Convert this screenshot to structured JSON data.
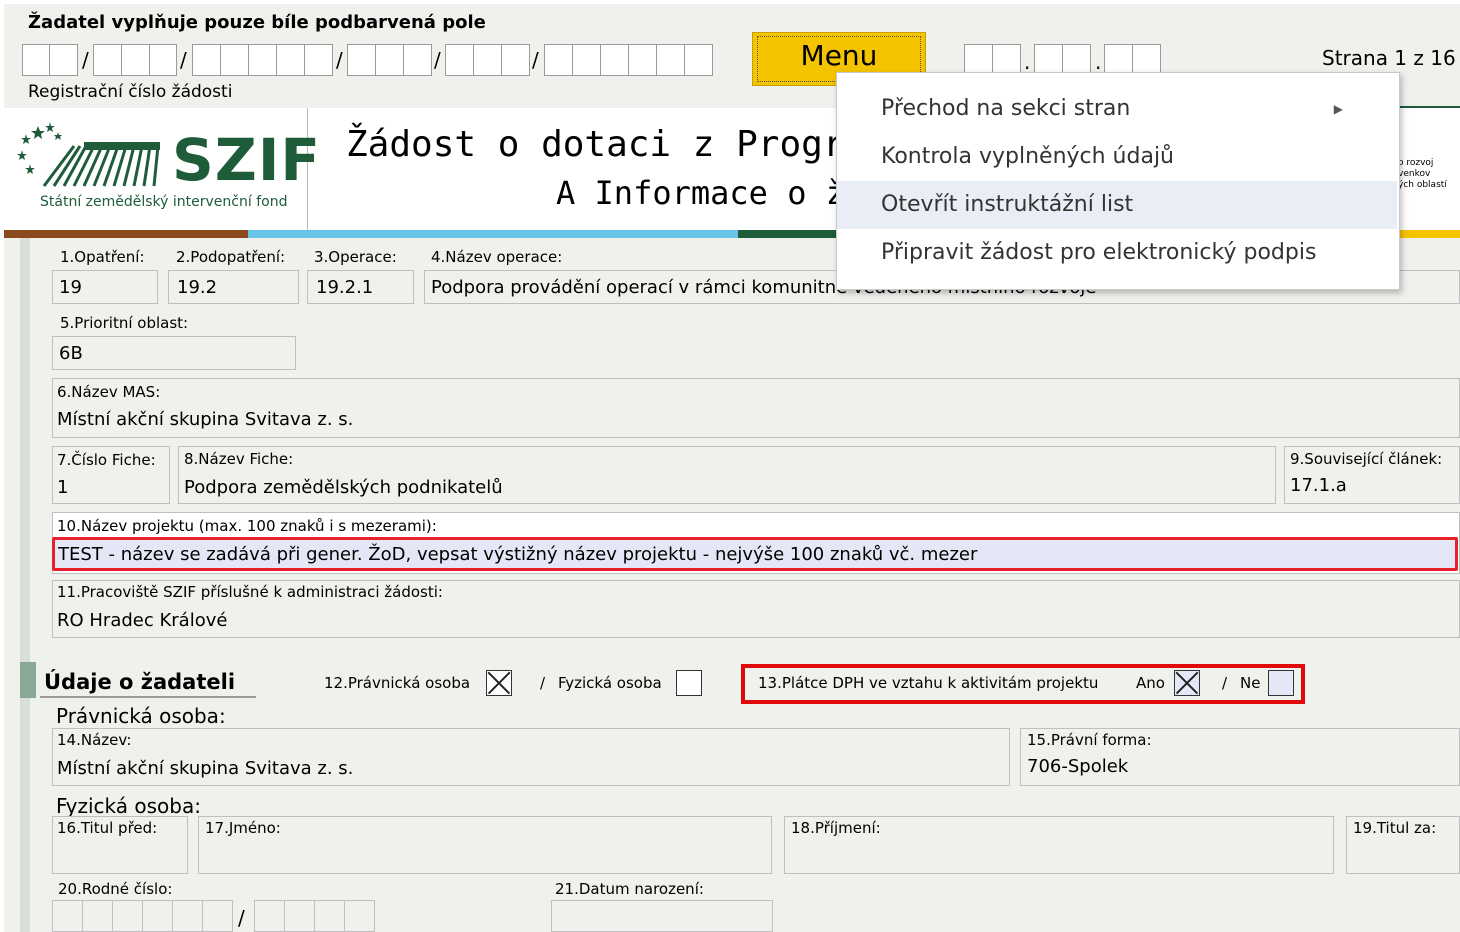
{
  "header": {
    "instruction": "Žadatel vyplňuje pouze bíle podbarvená pole",
    "reg_label": "Registrační číslo žádosti",
    "menu_button": "Menu",
    "page_indicator": "Strana 1 z 16",
    "date_dots": [
      ".",
      "."
    ]
  },
  "logo": {
    "brand": "SZIF",
    "subtitle": "Státní zemědělský intervenční fond"
  },
  "title": {
    "line1": "Žádost o dotaci z Programu",
    "line2": "A Informace o ža"
  },
  "menu": {
    "items": [
      {
        "label": "Přechod na sekci stran",
        "has_submenu": true
      },
      {
        "label": "Kontrola vyplněných údajů"
      },
      {
        "label": "Otevřít instruktážní list"
      },
      {
        "label": "Připravit žádost pro elektronický podpis"
      }
    ],
    "highlighted_index": 2
  },
  "right_logo_text": [
    "o rozvoj venkov",
    "ých oblastí"
  ],
  "fields": {
    "f1_label": "1.Opatření:",
    "f1_value": "19",
    "f2_label": "2.Podopatření:",
    "f2_value": "19.2",
    "f3_label": "3.Operace:",
    "f3_value": "19.2.1",
    "f4_label": "4.Název operace:",
    "f4_value": "Podpora provádění operací v rámci komunitně vedeného místního rozvoje",
    "f5_label": "5.Prioritní oblast:",
    "f5_value": "6B",
    "f6_label": "6.Název MAS:",
    "f6_value": "Místní akční skupina Svitava z. s.",
    "f7_label": "7.Číslo Fiche:",
    "f7_value": "1",
    "f8_label": "8.Název Fiche:",
    "f8_value": "Podpora zemědělských podnikatelů",
    "f9_label": "9.Související článek:",
    "f9_value": "17.1.a",
    "f10_label": "10.Název projektu (max. 100 znaků i s mezerami):",
    "f10_value": "TEST - název se zadává při gener. ŽoD, vepsat výstižný název projektu - nejvýše 100 znaků vč. mezer",
    "f11_label": "11.Pracoviště SZIF příslušné k administraci žádosti:",
    "f11_value": "RO Hradec Králové"
  },
  "applicant": {
    "section_title": "Údaje o žadateli",
    "f12_legal_label": "12.Právnická osoba",
    "f12_legal_checked": true,
    "f12_sep": "/",
    "f12_natural_label": "Fyzická osoba",
    "f12_natural_checked": false,
    "f13_label": "13.Plátce DPH ve vztahu k aktivitám projektu",
    "f13_yes_label": "Ano",
    "f13_yes_checked": true,
    "f13_sep": "/",
    "f13_no_label": "Ne",
    "f13_no_checked": false,
    "legal_heading": "Právnická osoba:",
    "f14_label": "14.Název:",
    "f14_value": "Místní akční skupina Svitava z. s.",
    "f15_label": "15.Právní forma:",
    "f15_value": "706-Spolek",
    "natural_heading": "Fyzická osoba:",
    "f16_label": "16.Titul před:",
    "f17_label": "17.Jméno:",
    "f18_label": "18.Příjmení:",
    "f19_label": "19.Titul za:",
    "f20_label": "20.Rodné číslo:",
    "f21_label": "21.Datum narození:",
    "birth_sep": "/"
  },
  "colors": {
    "background_gray": "#eef1ec",
    "menu_yellow": "#f5c400",
    "logo_green": "#1e5c3a",
    "highlight_red": "#e8212b",
    "menu_hover": "#e9eef6",
    "field_blue": "#e4e8f6"
  }
}
